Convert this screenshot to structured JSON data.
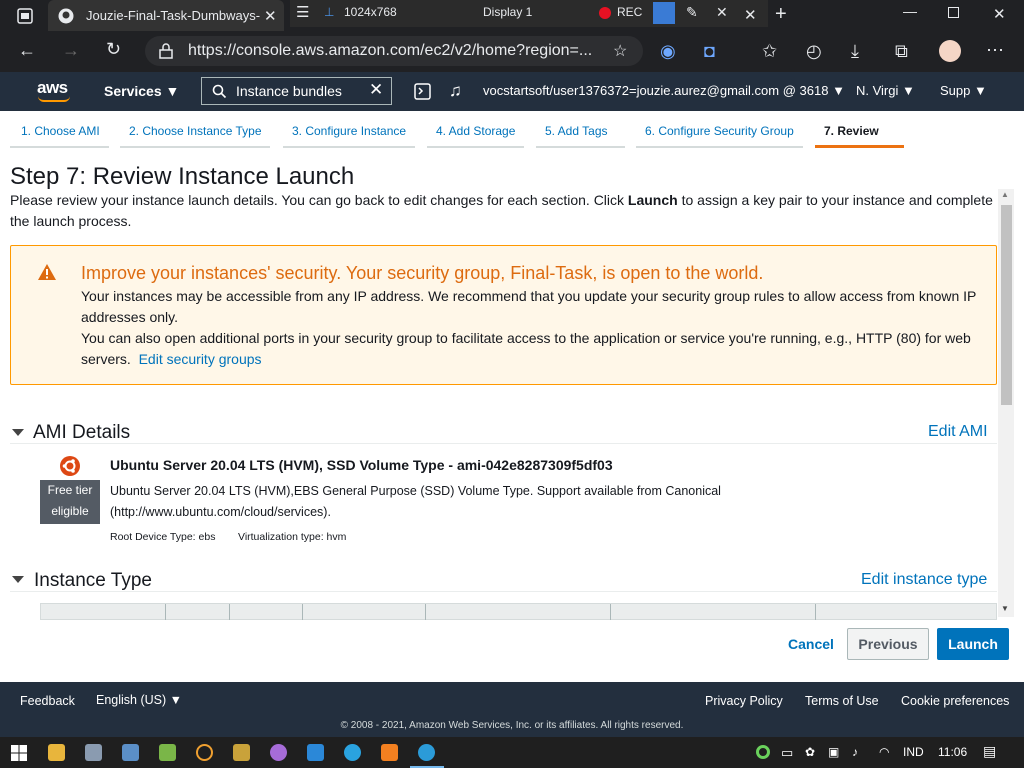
{
  "browser": {
    "tab_title": "Jouzie-Final-Task-Dumbways-Ba",
    "recorder": {
      "resolution": "1024x768",
      "display": "Display 1",
      "rec": "REC"
    },
    "url": "https://console.aws.amazon.com/ec2/v2/home?region=..."
  },
  "aws_nav": {
    "services": "Services",
    "search_value": "Instance bundles",
    "account": "vocstartsoft/user1376372=jouzie.aurez@gmail.com @ 3618",
    "region": "N. Virgi",
    "support": "Supp"
  },
  "steps": [
    {
      "label": "1. Choose AMI"
    },
    {
      "label": "2. Choose Instance Type"
    },
    {
      "label": "3. Configure Instance"
    },
    {
      "label": "4. Add Storage"
    },
    {
      "label": "5. Add Tags"
    },
    {
      "label": "6. Configure Security Group"
    },
    {
      "label": "7. Review"
    }
  ],
  "page": {
    "title": "Step 7: Review Instance Launch",
    "intro_before": "Please review your instance launch details. You can go back to edit changes for each section. Click ",
    "intro_bold": "Launch",
    "intro_after": " to assign a key pair to your instance and complete the launch process."
  },
  "warning": {
    "title": "Improve your instances' security. Your security group, Final-Task, is open to the world.",
    "line1": "Your instances may be accessible from any IP address. We recommend that you update your security group rules to allow access from known IP addresses only.",
    "line2": "You can also open additional ports in your security group to facilitate access to the application or service you're running, e.g., HTTP (80) for web servers.",
    "link": "Edit security groups"
  },
  "ami_section": {
    "heading": "AMI Details",
    "edit": "Edit AMI",
    "name": "Ubuntu Server 20.04 LTS (HVM), SSD Volume Type - ami-042e8287309f5df03",
    "description": "Ubuntu Server 20.04 LTS (HVM),EBS General Purpose (SSD) Volume Type. Support available from Canonical (http://www.ubuntu.com/cloud/services).",
    "root_device": "Root Device Type: ebs",
    "virtualization": "Virtualization type: hvm",
    "free_tier": "Free tier eligible"
  },
  "instance_section": {
    "heading": "Instance Type",
    "edit": "Edit instance type"
  },
  "actions": {
    "cancel": "Cancel",
    "previous": "Previous",
    "launch": "Launch"
  },
  "footer": {
    "feedback": "Feedback",
    "language": "English (US)",
    "privacy": "Privacy Policy",
    "terms": "Terms of Use",
    "cookies": "Cookie preferences",
    "copyright": "© 2008 - 2021, Amazon Web Services, Inc. or its affiliates. All rights reserved."
  },
  "taskbar": {
    "lang": "IND",
    "time": "11:06"
  },
  "colors": {
    "aws_nav": "#232f3e",
    "aws_orange": "#ff9900",
    "link_blue": "#0073bb",
    "warning_bg": "#fff7e8",
    "warning_text": "#dd6b10"
  }
}
